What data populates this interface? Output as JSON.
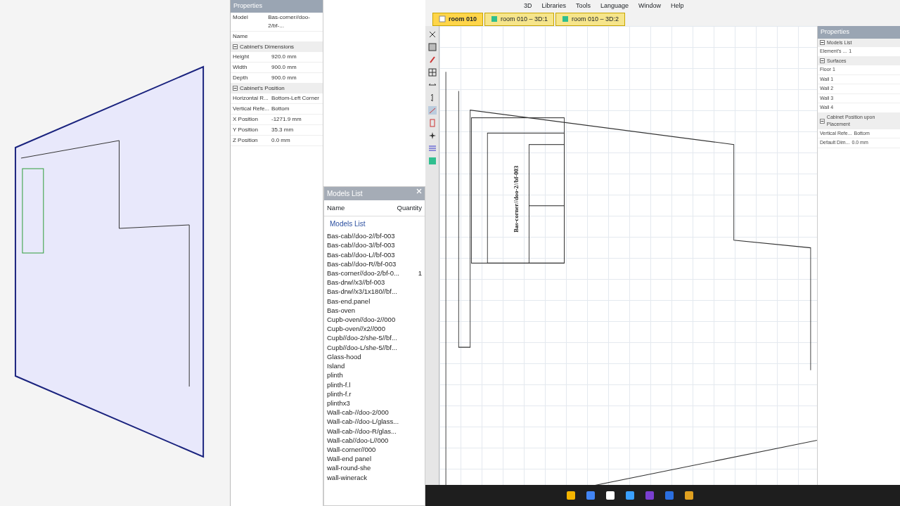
{
  "left_window": {
    "properties": {
      "title": "Properties",
      "rows": [
        {
          "kind": "row",
          "label": "Model",
          "value": "Bas-corner//doo-2/bf-..."
        },
        {
          "kind": "row",
          "label": "Name"
        },
        {
          "kind": "group",
          "label": "Cabinet's Dimensions",
          "expanded": true
        },
        {
          "kind": "row",
          "label": "Height",
          "value": "920.0 mm"
        },
        {
          "kind": "row",
          "label": "Width",
          "value": "900.0 mm"
        },
        {
          "kind": "row",
          "label": "Depth",
          "value": "900.0 mm"
        },
        {
          "kind": "group",
          "label": "Cabinet's Position",
          "expanded": true
        },
        {
          "kind": "row",
          "label": "Horizontal R...",
          "value": "Bottom-Left Corner"
        },
        {
          "kind": "row",
          "label": "Vertical Refe...",
          "value": "Bottom"
        },
        {
          "kind": "row",
          "label": "X Position",
          "value": "-1271.9 mm"
        },
        {
          "kind": "row",
          "label": "Y Position",
          "value": "35.3 mm"
        },
        {
          "kind": "row",
          "label": "Z Position",
          "value": "0.0 mm"
        }
      ]
    }
  },
  "models_panel": {
    "title": "Models List",
    "columns": [
      "Name",
      "Quantity"
    ],
    "group": "Models List",
    "items": [
      {
        "name": "Bas-cab//doo-2//bf-003"
      },
      {
        "name": "Bas-cab//doo-3//bf-003"
      },
      {
        "name": "Bas-cab//doo-L//bf-003"
      },
      {
        "name": "Bas-cab//doo-R//bf-003"
      },
      {
        "name": "Bas-corner//doo-2/bf-0...",
        "quantity": "1"
      },
      {
        "name": "Bas-drw//x3//bf-003"
      },
      {
        "name": "Bas-drw//x3/1x180//bf..."
      },
      {
        "name": "Bas-end.panel"
      },
      {
        "name": "Bas-oven"
      },
      {
        "name": "Cupb-oven//doo-2//000"
      },
      {
        "name": "Cupb-oven//x2//000"
      },
      {
        "name": "Cupb//doo-2/she-5//bf..."
      },
      {
        "name": "Cupb//doo-L/she-5//bf..."
      },
      {
        "name": "Glass-hood"
      },
      {
        "name": "Island"
      },
      {
        "name": "plinth"
      },
      {
        "name": "plinth-f.l"
      },
      {
        "name": "plinth-f.r"
      },
      {
        "name": "plinthx3"
      },
      {
        "name": "Wall-cab-//doo-2/000"
      },
      {
        "name": "Wall-cab-//doo-L/glass..."
      },
      {
        "name": "Wall-cab-//doo-R/glas..."
      },
      {
        "name": "Wall-cab//doo-L//000"
      },
      {
        "name": "Wall-corner//000"
      },
      {
        "name": "Wall-end panel"
      },
      {
        "name": "wall-round-she"
      },
      {
        "name": "wall-winerack"
      }
    ]
  },
  "main_window": {
    "menu": [
      "3D",
      "Libraries",
      "Tools",
      "Language",
      "Window",
      "Help"
    ],
    "tabs": [
      {
        "label": "room 010",
        "kind": "plan",
        "selected": true
      },
      {
        "label": "room 010 – 3D:1",
        "kind": "view",
        "selected": false
      },
      {
        "label": "room 010 – 3D:2",
        "kind": "view",
        "selected": false
      }
    ],
    "drawing": {
      "label": "Bas-corner//doo-2//bf-003"
    },
    "side_panel": {
      "title": "Properties",
      "rows": [
        {
          "kind": "group",
          "label": "Models List",
          "expanded": true
        },
        {
          "kind": "row",
          "label": "Element's ...",
          "value": "1"
        },
        {
          "kind": "group",
          "label": "Surfaces",
          "expanded": true
        },
        {
          "kind": "row",
          "label": "Floor 1"
        },
        {
          "kind": "row",
          "label": "Wall 1"
        },
        {
          "kind": "row",
          "label": "Wall 2"
        },
        {
          "kind": "row",
          "label": "Wall 3"
        },
        {
          "kind": "row",
          "label": "Wall 4"
        },
        {
          "kind": "group",
          "label": "Cabinet Position upon Placement",
          "expanded": true
        },
        {
          "kind": "row",
          "label": "Vertical Refe...",
          "value": "Bottom"
        },
        {
          "kind": "row",
          "label": "Default Dim...",
          "value": "0.0 mm"
        }
      ]
    }
  }
}
